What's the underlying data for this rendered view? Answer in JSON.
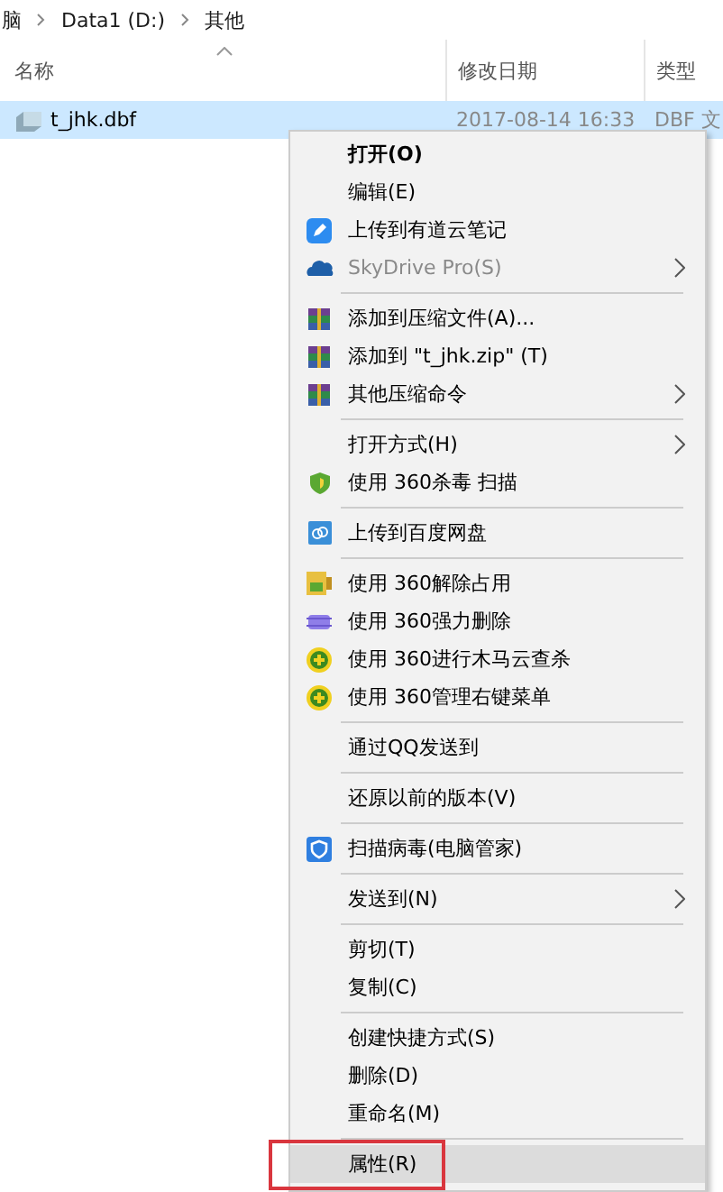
{
  "breadcrumb": [
    "脑",
    "Data1 (D:)",
    "其他"
  ],
  "columns": [
    {
      "label": "名称",
      "sorted": true
    },
    {
      "label": "修改日期",
      "sorted": false
    },
    {
      "label": "类型",
      "sorted": false
    }
  ],
  "file": {
    "name": "t_jhk.dbf",
    "modified": "2017-08-14 16:33",
    "type": "DBF 文",
    "selected": true
  },
  "menu": [
    [
      {
        "label": "打开(O)",
        "default": true,
        "disabled": false,
        "submenu": false,
        "selected": false
      },
      {
        "label": "编辑(E)",
        "default": false,
        "disabled": false,
        "submenu": false,
        "selected": false
      },
      {
        "label": "上传到有道云笔记",
        "default": false,
        "disabled": false,
        "submenu": false,
        "selected": false,
        "kind": "note"
      },
      {
        "label": "SkyDrive Pro(S)",
        "default": false,
        "disabled": true,
        "submenu": true,
        "selected": false,
        "kind": "cloud"
      }
    ],
    [
      {
        "label": "添加到压缩文件(A)...",
        "default": false,
        "disabled": false,
        "submenu": false,
        "selected": false,
        "kind": "archive"
      },
      {
        "label": "添加到 \"t_jhk.zip\" (T)",
        "default": false,
        "disabled": false,
        "submenu": false,
        "selected": false,
        "kind": "archive"
      },
      {
        "label": "其他压缩命令",
        "default": false,
        "disabled": false,
        "submenu": true,
        "selected": false,
        "kind": "archive"
      }
    ],
    [
      {
        "label": "打开方式(H)",
        "default": false,
        "disabled": false,
        "submenu": true,
        "selected": false
      },
      {
        "label": "使用 360杀毒 扫描",
        "default": false,
        "disabled": false,
        "submenu": false,
        "selected": false,
        "kind": "shield"
      }
    ],
    [
      {
        "label": "上传到百度网盘",
        "default": false,
        "disabled": false,
        "submenu": false,
        "selected": false,
        "kind": "upload"
      }
    ],
    [
      {
        "label": "使用 360解除占用",
        "default": false,
        "disabled": false,
        "submenu": false,
        "selected": false,
        "kind": "unlock"
      },
      {
        "label": "使用 360强力删除",
        "default": false,
        "disabled": false,
        "submenu": false,
        "selected": false,
        "kind": "shred"
      },
      {
        "label": "使用 360进行木马云查杀",
        "default": false,
        "disabled": false,
        "submenu": false,
        "selected": false,
        "kind": "plus"
      },
      {
        "label": "使用 360管理右键菜单",
        "default": false,
        "disabled": false,
        "submenu": false,
        "selected": false,
        "kind": "plus"
      }
    ],
    [
      {
        "label": "通过QQ发送到",
        "default": false,
        "disabled": false,
        "submenu": false,
        "selected": false
      }
    ],
    [
      {
        "label": "还原以前的版本(V)",
        "default": false,
        "disabled": false,
        "submenu": false,
        "selected": false
      }
    ],
    [
      {
        "label": "扫描病毒(电脑管家)",
        "default": false,
        "disabled": false,
        "submenu": false,
        "selected": false,
        "kind": "guard"
      }
    ],
    [
      {
        "label": "发送到(N)",
        "default": false,
        "disabled": false,
        "submenu": true,
        "selected": false
      }
    ],
    [
      {
        "label": "剪切(T)",
        "default": false,
        "disabled": false,
        "submenu": false,
        "selected": false
      },
      {
        "label": "复制(C)",
        "default": false,
        "disabled": false,
        "submenu": false,
        "selected": false
      }
    ],
    [
      {
        "label": "创建快捷方式(S)",
        "default": false,
        "disabled": false,
        "submenu": false,
        "selected": false
      },
      {
        "label": "删除(D)",
        "default": false,
        "disabled": false,
        "submenu": false,
        "selected": false
      },
      {
        "label": "重命名(M)",
        "default": false,
        "disabled": false,
        "submenu": false,
        "selected": false
      }
    ],
    [
      {
        "label": "属性(R)",
        "default": false,
        "disabled": false,
        "submenu": false,
        "selected": true
      }
    ]
  ]
}
